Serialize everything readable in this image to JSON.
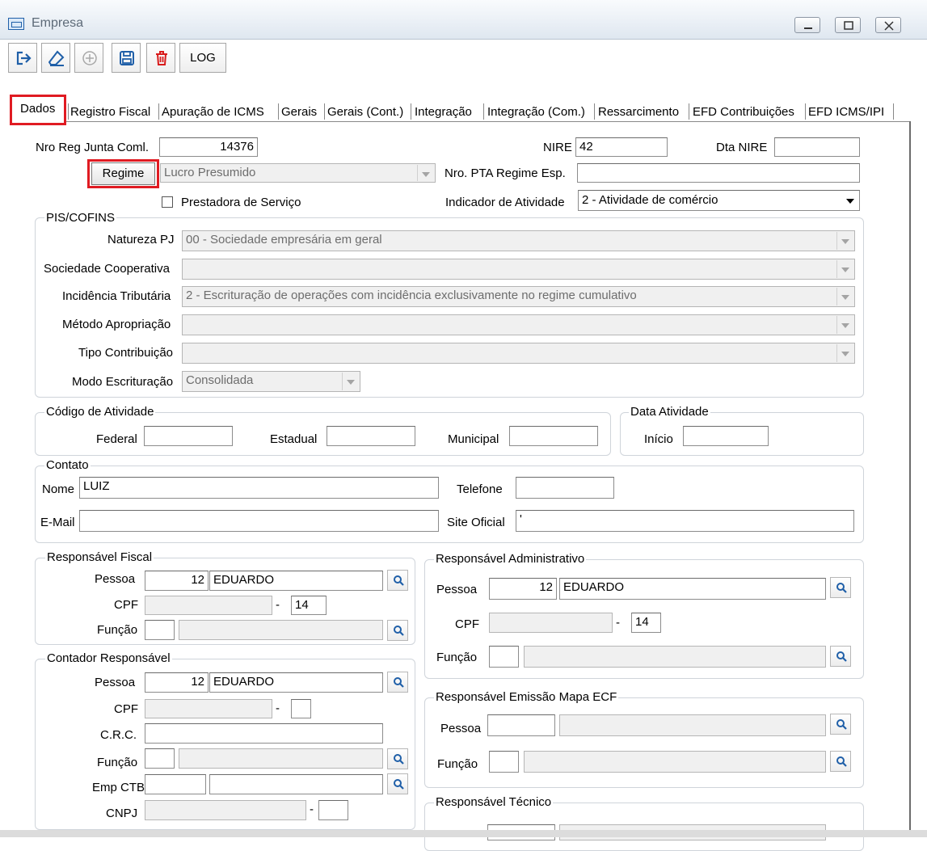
{
  "window": {
    "title": "Empresa"
  },
  "toolbar": {
    "log_label": "LOG"
  },
  "tabs": [
    "Dados",
    "Registro Fiscal",
    "Apuração de ICMS",
    "Gerais",
    "Gerais (Cont.)",
    "Integração",
    "Integração (Com.)",
    "Ressarcimento",
    "EFD Contribuições",
    "EFD ICMS/IPI"
  ],
  "top": {
    "nro_reg_label": "Nro Reg Junta Coml.",
    "nro_reg_value": "14376",
    "nire_label": "NIRE",
    "nire_value": "42",
    "dta_nire_label": "Dta NIRE",
    "dta_nire_value": "",
    "regime_button": "Regime",
    "regime_value": "Lucro Presumido",
    "pta_label": "Nro. PTA Regime Esp.",
    "pta_value": "",
    "prestadora_label": "Prestadora de Serviço",
    "indicador_label": "Indicador de Atividade",
    "indicador_value": "2 - Atividade de comércio"
  },
  "pis_cofins": {
    "title": "PIS/COFINS",
    "natureza_label": "Natureza PJ",
    "natureza_value": "00 - Sociedade empresária em geral",
    "cooperativa_label": "Sociedade Cooperativa",
    "cooperativa_value": "",
    "incidencia_label": "Incidência Tributária",
    "incidencia_value": "2 - Escrituração de operações com incidência exclusivamente no regime cumulativo",
    "metodo_label": "Método Apropriação",
    "metodo_value": "",
    "tipo_label": "Tipo Contribuição",
    "tipo_value": "",
    "modo_label": "Modo Escrituração",
    "modo_value": "Consolidada"
  },
  "codigo_atividade": {
    "title": "Código de Atividade",
    "federal_label": "Federal",
    "estadual_label": "Estadual",
    "municipal_label": "Municipal"
  },
  "data_atividade": {
    "title": "Data Atividade",
    "inicio_label": "Início"
  },
  "contato": {
    "title": "Contato",
    "nome_label": "Nome",
    "nome_value": "LUIZ",
    "telefone_label": "Telefone",
    "email_label": "E-Mail",
    "site_label": "Site Oficial",
    "site_value": "'"
  },
  "resp_fiscal": {
    "title": "Responsável Fiscal",
    "pessoa_label": "Pessoa",
    "pessoa_code": "12",
    "pessoa_name": "EDUARDO",
    "cpf_label": "CPF",
    "cpf_dv": "14",
    "funcao_label": "Função"
  },
  "resp_admin": {
    "title": "Responsável Administrativo",
    "pessoa_label": "Pessoa",
    "pessoa_code": "12",
    "pessoa_name": "EDUARDO",
    "cpf_label": "CPF",
    "cpf_dv": "14",
    "funcao_label": "Função"
  },
  "contador": {
    "title": "Contador Responsável",
    "pessoa_label": "Pessoa",
    "pessoa_code": "12",
    "pessoa_name": "EDUARDO",
    "cpf_label": "CPF",
    "crc_label": "C.R.C.",
    "funcao_label": "Função",
    "empctb_label": "Emp CTB",
    "cnpj_label": "CNPJ"
  },
  "resp_ecf": {
    "title": "Responsável Emissão Mapa ECF",
    "pessoa_label": "Pessoa",
    "funcao_label": "Função"
  },
  "resp_tecnico": {
    "title": "Responsável Técnico"
  },
  "colors": {
    "highlight": "#e01b22",
    "search_icon": "#1f5fa8"
  }
}
